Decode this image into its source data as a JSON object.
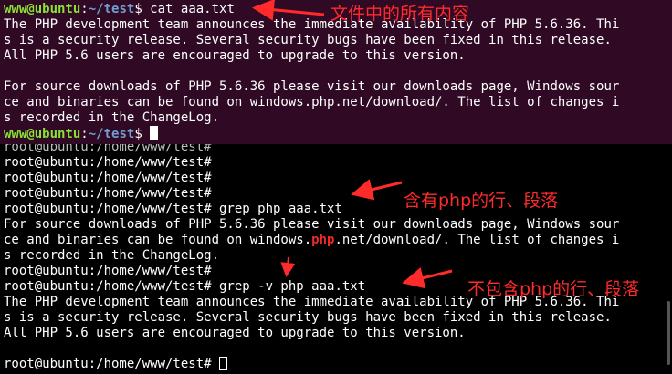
{
  "colors": {
    "top_bg": "#300a24",
    "bottom_bg": "#000000",
    "text": "#ffffff",
    "user_green": "#8ae234",
    "path_blue": "#729fcf",
    "match_red": "#ef2929",
    "annotation_red": "#ff2a2a"
  },
  "top_pane": {
    "prompt_user": "www@ubuntu",
    "prompt_sep": ":",
    "prompt_path": "~/test",
    "prompt_symbol": "$ ",
    "command": "cat aaa.txt",
    "output": [
      "The PHP development team announces the immediate availability of PHP 5.6.36. Thi",
      "s is a security release. Several security bugs have been fixed in this release.",
      "All PHP 5.6 users are encouraged to upgrade to this version.",
      "",
      "For source downloads of PHP 5.6.36 please visit our downloads page, Windows sour",
      "ce and binaries can be found on windows.php.net/download/. The list of changes i",
      "s recorded in the ChangeLog."
    ]
  },
  "bottom_pane": {
    "root_prompt": "root@ubuntu:/home/www/test#",
    "grep_command": " grep php aaa.txt",
    "grep_output": {
      "line1": "For source downloads of PHP 5.6.36 please visit our downloads page, Windows sour",
      "line2_before": "ce and binaries can be found on windows.",
      "line2_match": "php",
      "line2_after": ".net/download/. The list of changes i",
      "line3": "s recorded in the ChangeLog."
    },
    "grepv_command": " grep -v php aaa.txt",
    "grepv_output": [
      "The PHP development team announces the immediate availability of PHP 5.6.36. Thi",
      "s is a security release. Several security bugs have been fixed in this release.",
      "All PHP 5.6 users are encouraged to upgrade to this version.",
      ""
    ]
  },
  "annotations": {
    "cat_note": "文件中的所有内容",
    "grep_note": "含有php的行、段落",
    "grepv_note": "不包含php的行、段落"
  }
}
